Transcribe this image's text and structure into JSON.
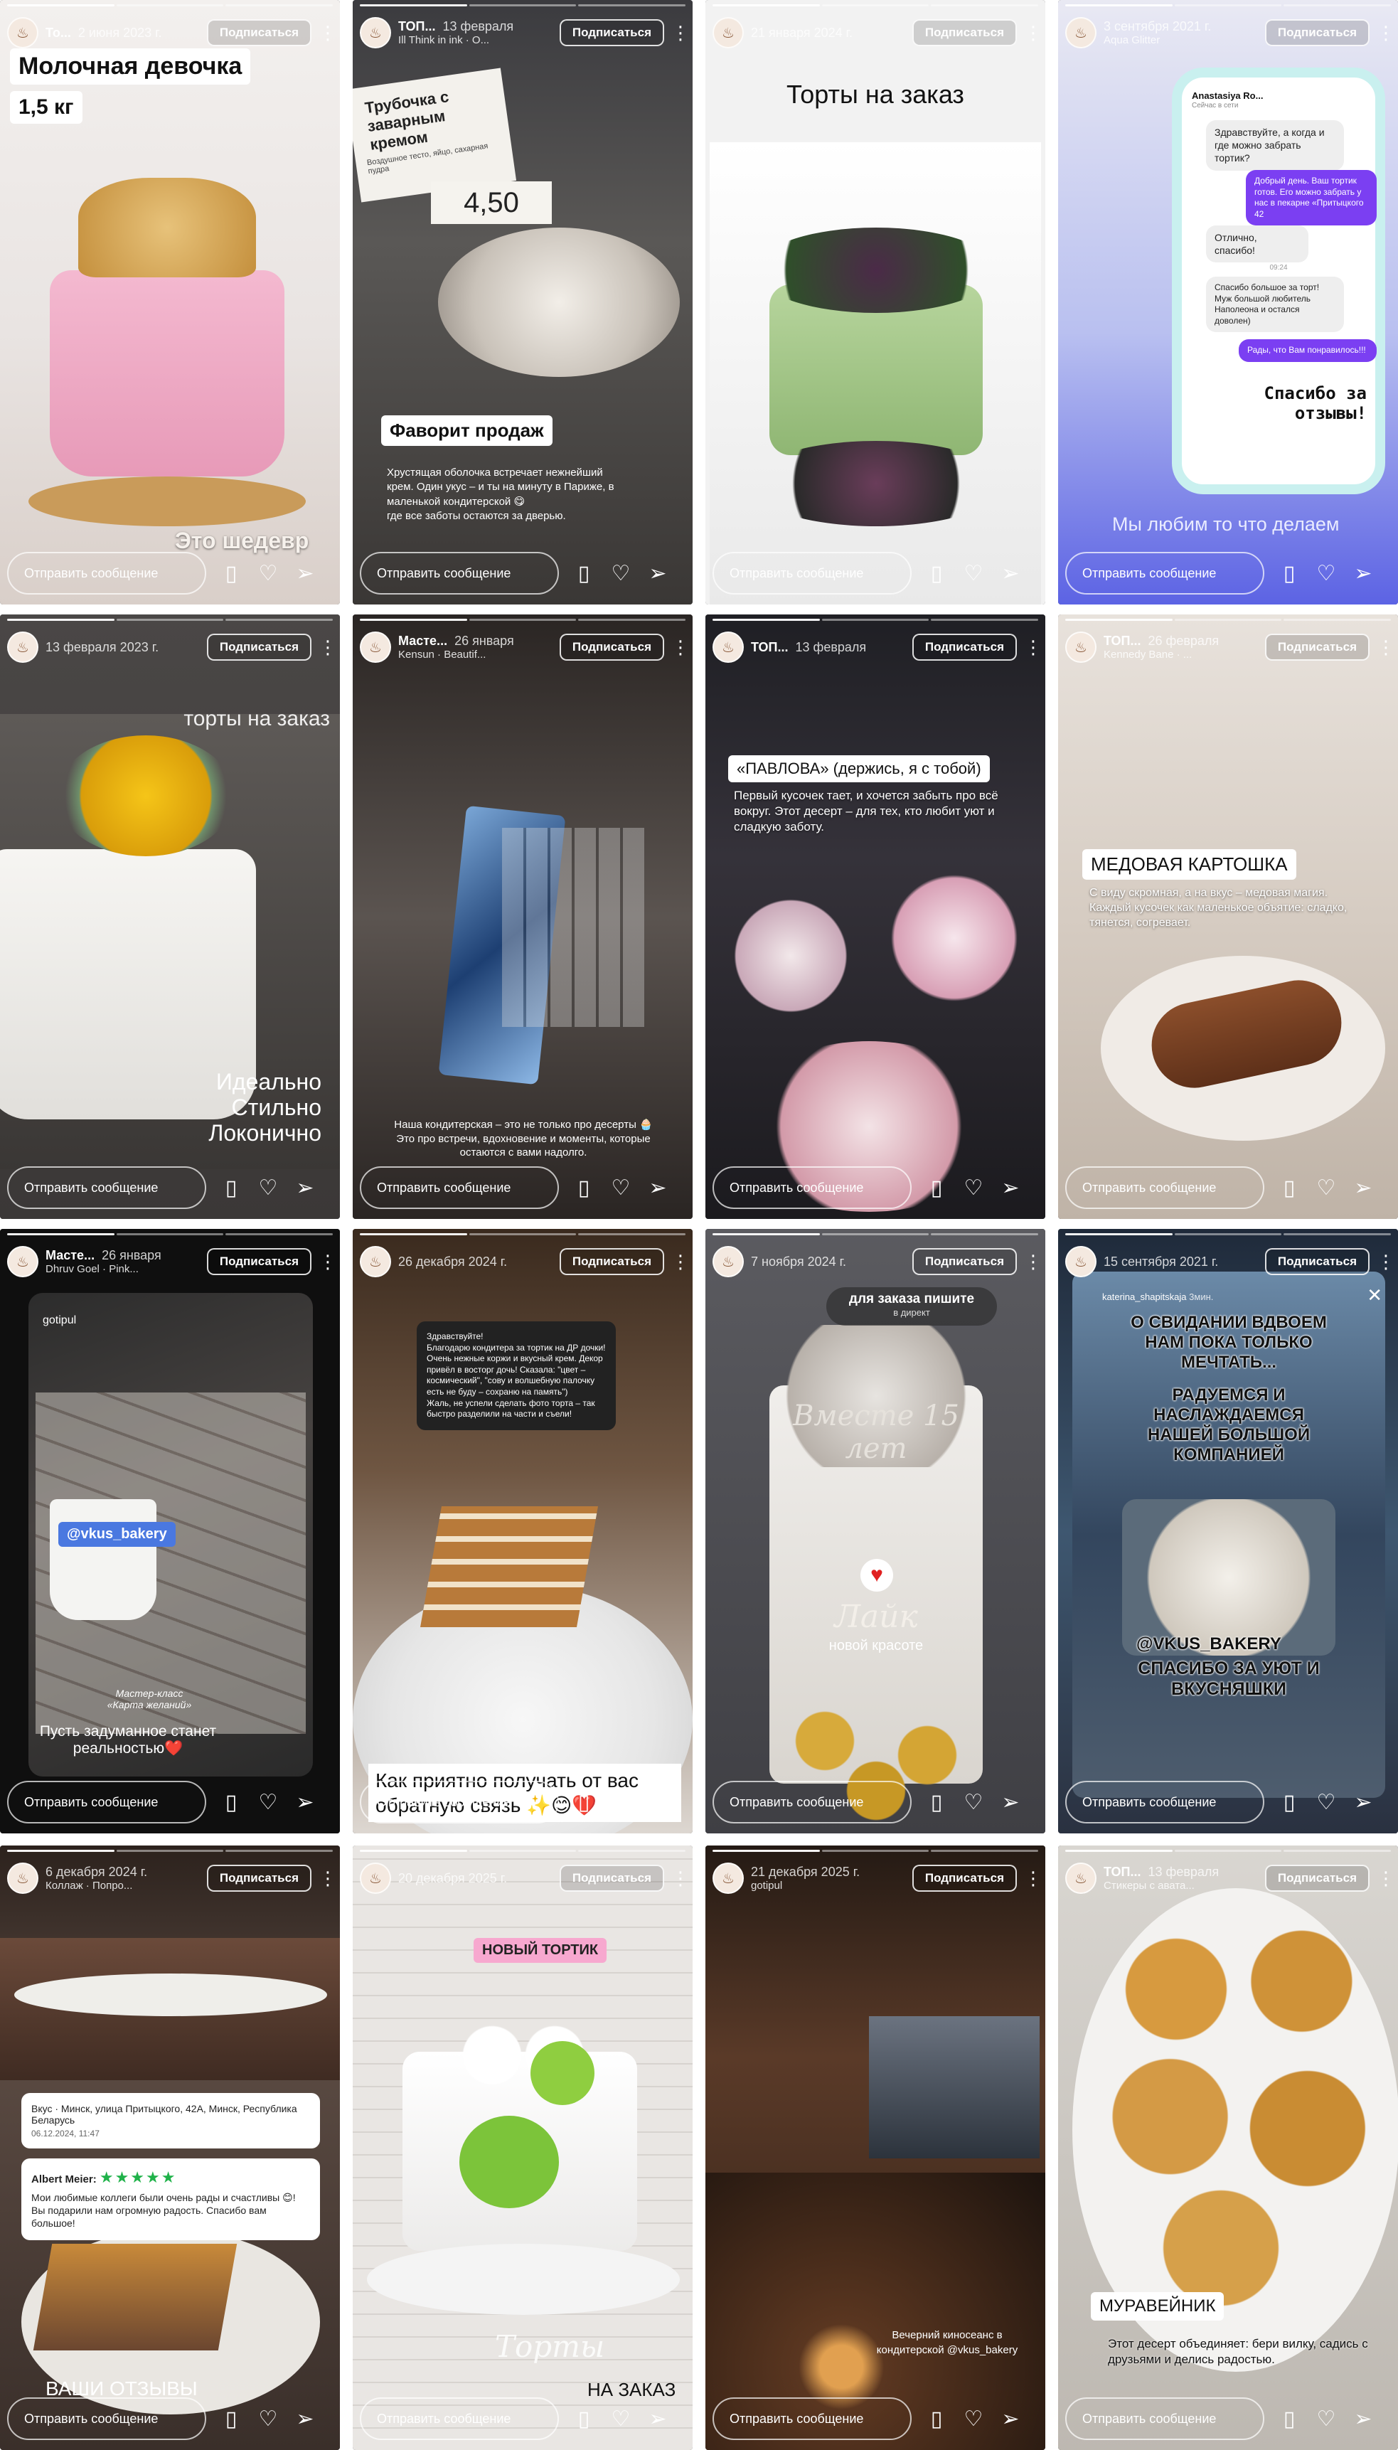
{
  "common": {
    "follow_label": "Подписаться",
    "reply_placeholder": "Отправить сообщение",
    "avatar_glyph": "♨"
  },
  "stories": [
    {
      "name": "То...",
      "date": "2 июня 2023 г.",
      "music": "",
      "title": "Молочная девочка",
      "weight": "1,5 кг",
      "bottom_text": "Это шедевр"
    },
    {
      "name": "ТОП...",
      "date": "13 февраля",
      "music": "Ill Think in ink · O...",
      "sign_title": "Трубочка с заварным кремом",
      "sign_sub": "Воздушное тесто, яйцо, сахарная пудра",
      "price": "4,50",
      "label": "Фаворит продаж",
      "caption": "Хрустящая оболочка встречает нежнейший крем. Один укус – и ты на минуту в Париже, в маленькой кондитерской 😋\nгде все заботы остаются за дверью."
    },
    {
      "name": "",
      "date": "21 января 2024 г.",
      "music": "",
      "title": "Торты на заказ"
    },
    {
      "name": "",
      "date": "3 сентября 2021 г.",
      "music": "Aqua Glitter",
      "chat_name": "Anastasiya Ro...",
      "chat_status": "Сейчас в сети",
      "msg1": "Здравствуйте, а когда и где можно забрать тортик?",
      "msg2": "Добрый день. Ваш тортик готов. Его можно забрать у нас в пекарне «Притыцкого 42",
      "msg3": "Отлично, спасибо!",
      "msg_time": "09:24",
      "msg4": "Спасибо большое за торт! Муж большой любитель Наполеона и остался доволен)",
      "msg5": "Рады, что Вам понравилось!!!",
      "thanks": "Спасибо за отзывы!",
      "bottom_text": "Мы любим то что делаем"
    },
    {
      "name": "",
      "date": "13 февраля 2023 г.",
      "music": "",
      "top_text": "торты на заказ",
      "bottom_text": "Идеально\nСтильно\nЛоконично"
    },
    {
      "name": "Масте...",
      "date": "26 января",
      "music": "Kensun · Beautif...",
      "caption": "Наша кондитерская – это не только про десерты 🧁\nЭто про встречи, вдохновение и моменты, которые остаются с вами надолго."
    },
    {
      "name": "ТОП...",
      "date": "13 февраля",
      "music": "",
      "label": "«ПАВЛОВА» (держись, я с тобой)",
      "caption": "Первый кусочек тает, и хочется забыть про всё вокруг. Этот десерт – для тех, кто любит уют и сладкую заботу."
    },
    {
      "name": "ТОП...",
      "date": "26 февраля",
      "music": "Kennedy Bane · ...",
      "label": "МЕДОВАЯ КАРТОШКА",
      "caption": "С виду скромная, а на вкус – медовая магия. Каждый кусочек как маленькое объятие: сладко, тянется, согревает."
    },
    {
      "name": "Масте...",
      "date": "26 января",
      "music": "Dhruv Goel · Pink...",
      "repost_user": "gotipul",
      "tag": "@vkus_bakery",
      "sub": "Мастер-класс\n«Карта желаний»",
      "caption": "Пусть задуманное станет реальностью❤️"
    },
    {
      "name": "",
      "date": "26 декабря 2024 г.",
      "music": "",
      "review": "Здравствуйте!\nБлагодарю кондитера за тортик на ДР дочки! Очень нежные коржи и вкусный крем. Декор привёл в восторг дочь! Сказала: \"цвет – космический\", \"сову и волшебную палочку есть не буду – сохраню на память\")\nЖаль, не успели сделать фото торта – так быстро разделили на части и съели!",
      "caption": "Как приятно получать от вас обратную связь ✨😊❤️"
    },
    {
      "name": "",
      "date": "7 ноября 2024 г.",
      "music": "",
      "pill": "для заказа пишите",
      "pill_sub": "в директ",
      "topper": "Вместе 15 лет",
      "like": "Лайк",
      "like_sub": "новой красоте"
    },
    {
      "name": "",
      "date": "15 сентября 2021 г.",
      "music": "",
      "repost_user": "katerina_shapitskaja",
      "repost_time": "3мин.",
      "text1": "О СВИДАНИИ ВДВОЕМ НАМ ПОКА ТОЛЬКО МЕЧТАТЬ...",
      "text2": "РАДУЕМСЯ И НАСЛАЖДАЕМСЯ НАШЕЙ БОЛЬШОЙ КОМПАНИЕЙ",
      "tag": "@VKUS_BAKERY",
      "text3": "СПАСИБО ЗА УЮТ И ВКУСНЯШКИ"
    },
    {
      "name": "",
      "date": "6 декабря 2024 г.",
      "music": "Коллаж · Попро...",
      "place": "Вкус · Минск, улица Притыцкого, 42А, Минск, Республика Беларусь",
      "place_date": "06.12.2024, 11:47",
      "reviewer": "Albert Meier:",
      "stars": "★★★★★",
      "review": "Мои любимые коллеги были очень рады и счастливы 😊! Вы подарили нам огромную радость. Спасибо вам большое!",
      "title": "ВАШИ ОТЗЫВЫ"
    },
    {
      "name": "",
      "date": "20 декабря 2025 г.",
      "music": "",
      "badge": "НОВЫЙ ТОРТИК",
      "script": "Торты",
      "bottom_text": "НА ЗАКАЗ"
    },
    {
      "name": "",
      "date": "21 декабря 2025 г.",
      "music": "gotipul",
      "caption": "Вечерний киносеанс в кондитерской @vkus_bakery"
    },
    {
      "name": "ТОП...",
      "date": "13 февраля",
      "music": "Стикеры с авата...",
      "label": "МУРАВЕЙНИК",
      "caption": "Этот десерт объединяет: бери вилку, садись с друзьями и делись радостью."
    }
  ]
}
